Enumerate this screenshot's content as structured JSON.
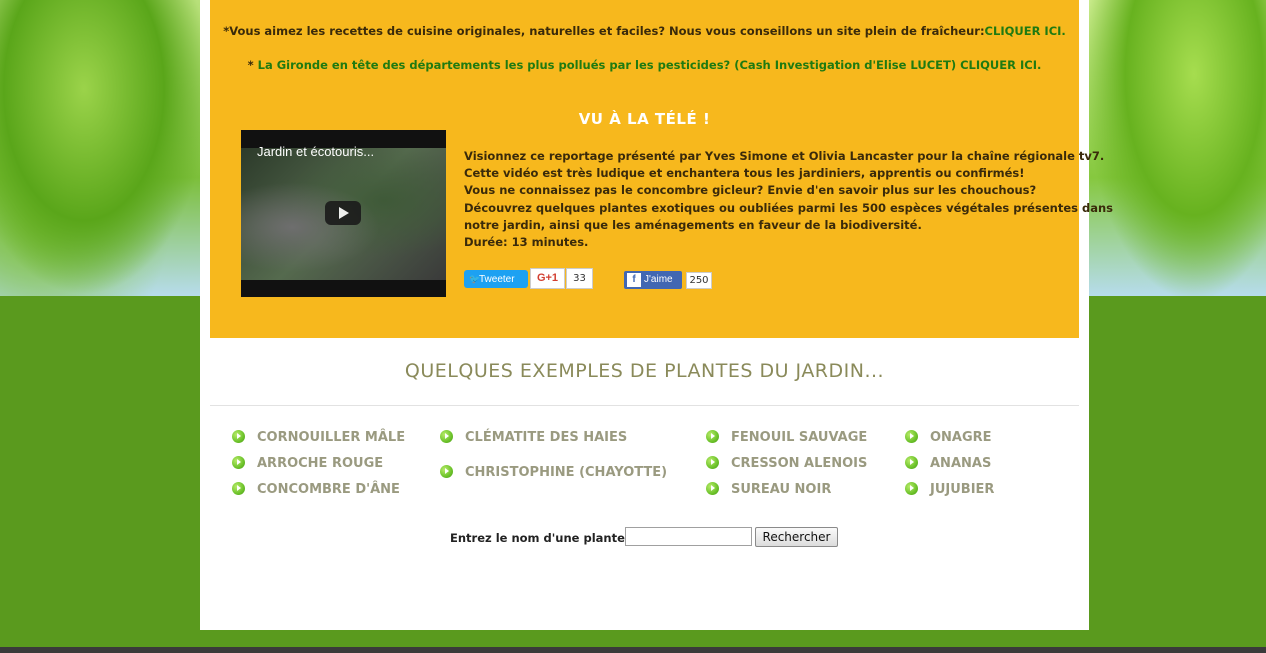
{
  "notices": {
    "recettes_text": "*Vous aimez les recettes de cuisine originales, naturelles et faciles? Nous vous conseillons un site plein de fraîcheur:",
    "recettes_link": "CLIQUER ICI.",
    "gironde_prefix": "* ",
    "gironde_text": "La Gironde en tête des départements les plus pollués par les pesticides? (Cash Investigation d'Elise LUCET)",
    "gironde_link": "CLIQUER ICI."
  },
  "tele": {
    "title": "VU À LA TÉLÉ !",
    "video_title": "Jardin et écotouris...",
    "description_lines": [
      "Visionnez ce reportage présenté par Yves Simone et Olivia Lancaster pour la chaîne régionale tv7.",
      "Cette vidéo est très ludique et enchantera tous les jardiniers, apprentis ou confirmés!",
      "Vous ne connaissez pas le concombre gicleur? Envie d'en savoir plus sur les chouchous?",
      "Découvrez quelques plantes exotiques ou oubliées parmi les 500 espèces végétales présentes dans",
      "notre jardin, ainsi que les aménagements en faveur de la biodiversité.",
      "Durée: 13 minutes."
    ]
  },
  "social": {
    "tweet_label": "Tweeter",
    "gplus_label": "G+1",
    "gplus_count": "33",
    "fb_icon": "f",
    "fb_label": "J'aime",
    "fb_count": "250"
  },
  "plants": {
    "title": "QUELQUES EXEMPLES DE PLANTES DU JARDIN...",
    "col1": [
      "CORNOUILLER MÂLE",
      "ARROCHE ROUGE",
      "CONCOMBRE D'ÂNE"
    ],
    "col2": [
      "CLÉMATITE DES HAIES",
      "CHRISTOPHINE (CHAYOTTE)"
    ],
    "col3": [
      "FENOUIL SAUVAGE",
      "CRESSON ALENOIS",
      "SUREAU NOIR"
    ],
    "col4": [
      "ONAGRE",
      "ANANAS",
      "JUJUBIER"
    ]
  },
  "search": {
    "label": "Entrez le nom d'une plante :",
    "value": "",
    "button": "Rechercher"
  }
}
